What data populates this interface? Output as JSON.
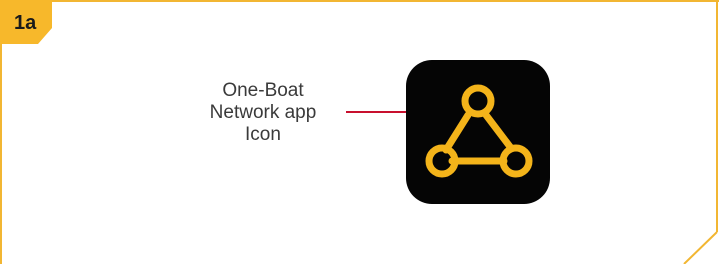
{
  "step": {
    "label": "1a"
  },
  "callout": {
    "lines": [
      "One-Boat",
      "Network app",
      "Icon"
    ]
  },
  "icon": {
    "name": "network-app-icon",
    "background_color": "#050505",
    "symbol_color": "#f4b41a"
  },
  "colors": {
    "frame_accent": "#f2b632",
    "tab_fill": "#f7b82b",
    "leader_line": "#c8102e",
    "text": "#3a3a3a"
  }
}
